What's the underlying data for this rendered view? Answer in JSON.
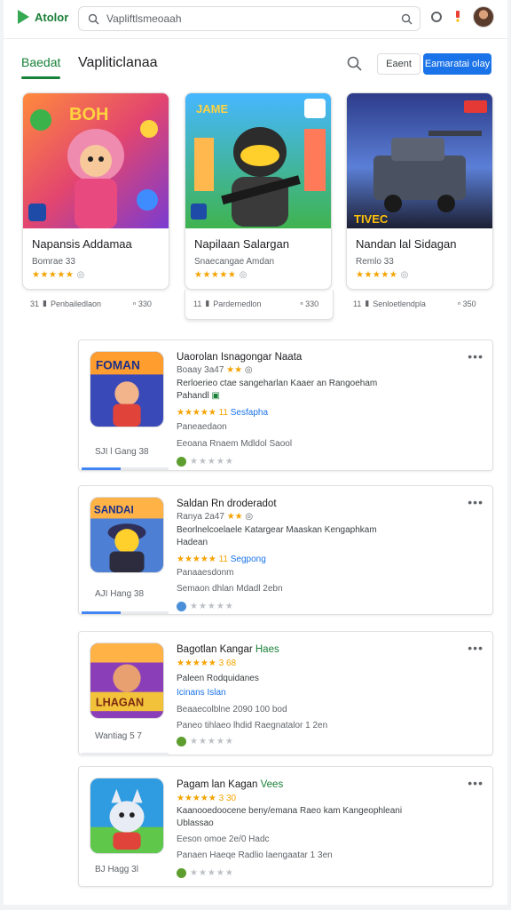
{
  "header": {
    "logo_text": "Atolor",
    "search_placeholder": "Vapliftlsmeoaah",
    "avatar": "avatar-photo"
  },
  "toolbar": {
    "tab_active": "Baedat",
    "page_title": "Vapliticlanaa",
    "btn_outline": "Eaent",
    "btn_primary": "Eamaratai olay"
  },
  "featured": [
    {
      "title": "Napansis Addamaa",
      "sub": "Bomrae 33",
      "stars": "★★★★★",
      "meta_label": "Penbailedlaon",
      "meta_rating": "ⁿ 330",
      "meta_prefix": "31"
    },
    {
      "title": "Napilaan Salargan",
      "sub": "Snaecangae Amdan",
      "stars": "★★★★★",
      "meta_label": "Pardernedlon",
      "meta_rating": "ⁿ 330",
      "meta_prefix": "11"
    },
    {
      "title": "Nandan lal Sidagan",
      "sub": "Remlo 33",
      "stars": "★★★★★",
      "meta_label": "Senloetlendpla",
      "meta_rating": "ⁿ 350",
      "meta_prefix": "11"
    }
  ],
  "list": [
    {
      "title": "Uaorolan Isnagongar Naata",
      "title_hl": "",
      "line1": "Boaay 3a47",
      "line1_stars": "★★",
      "line2": "Rerloerieo ctae sangeharlan Kaaer an Rangoeham",
      "line3": "Pahandl",
      "rating": "★★★★★ 11",
      "rating_link": "Sesfapha",
      "line4": "Paneaedaon",
      "line5": "Eeoana Rnaem Mdldol Saool",
      "size": "SJI l Gang 38",
      "progress": 0.45,
      "foot_stars": "★★★★★",
      "foot_color": "#5e9e2f"
    },
    {
      "title": "Saldan Rn droderadot",
      "title_hl": "",
      "line1": "Ranya 2a47",
      "line1_stars": "★★",
      "line2": "Beorlnelcoelaele Katargear Maaskan Kengaphkam",
      "line3": "Hadean",
      "rating": "★★★★★ 11",
      "rating_link": "Segpong",
      "line4": "Panaaesdonm",
      "line5": "Semaon dhlan Mdadl 2ebn",
      "size": "AJI Hang 38",
      "progress": 0.45,
      "foot_stars": "★★★★★",
      "foot_color": "#4a8fd8"
    },
    {
      "title": "Bagotlan Kangar ",
      "title_hl": "Haes",
      "line1": "",
      "line1_stars": "",
      "line2": "★★★★★ 3 68",
      "line3": "Paleen Rodquidanes",
      "rating": "",
      "rating_link": "Icinans Islan",
      "line4": "",
      "line5": "Beaaecolblne 2090 100 bod",
      "line6": "Paneo tihlaeo lhdid Raegnatalor 1 2en",
      "size": "Wantiag 5 7",
      "progress": 0,
      "foot_stars": "★★★★★",
      "foot_color": "#5e9e2f"
    },
    {
      "title": "Pagam lan Kagan ",
      "title_hl": "Vees",
      "line1": "",
      "line1_stars": "",
      "line2": "★★★★★ 3 30",
      "line3": "Kaanooedoocene beny/emana Raeo kam Kangeophleani",
      "rating": "",
      "rating_link": "",
      "line4": "Ublassao",
      "line5": "Eeson omoe 2e/0 Hadc",
      "line6": "Panaen Haeqe Radlio laengaatar 1 3en",
      "size": "BJ Hagg 3l",
      "progress": 0,
      "foot_stars": "★★★★★",
      "foot_color": "#5e9e2f"
    }
  ]
}
